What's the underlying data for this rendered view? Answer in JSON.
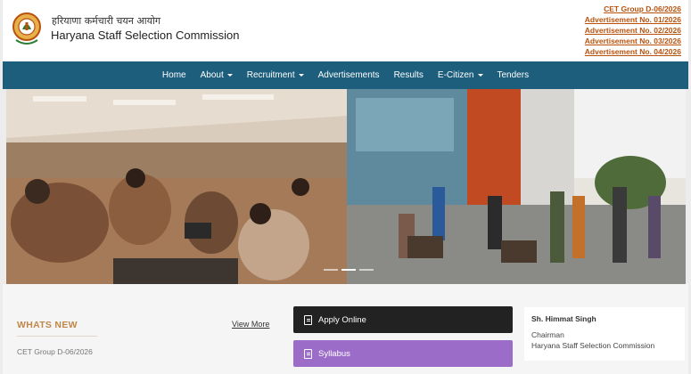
{
  "header": {
    "hindi_name": "हरियाणा कर्मचारी चयन आयोग",
    "org_name": "Haryana Staff Selection Commission",
    "links": [
      "CET Group D-06/2026",
      "Advertisement No. 01/2026",
      "Advertisement No. 02/2026",
      "Advertisement No. 03/2026",
      "Advertisement No. 04/2026"
    ]
  },
  "nav": {
    "items": [
      {
        "label": "Home",
        "dropdown": false
      },
      {
        "label": "About",
        "dropdown": true
      },
      {
        "label": "Recruitment",
        "dropdown": true
      },
      {
        "label": "Advertisements",
        "dropdown": false
      },
      {
        "label": "Results",
        "dropdown": false
      },
      {
        "label": "E-Citizen",
        "dropdown": true
      },
      {
        "label": "Tenders",
        "dropdown": false
      }
    ]
  },
  "whats_new": {
    "title": "WHATS NEW",
    "view_more": "View More",
    "items": [
      "CET Group D-06/2026"
    ]
  },
  "actions": {
    "apply_online": "Apply Online",
    "syllabus": "Syllabus"
  },
  "chairman": {
    "name": "Sh. Himmat Singh",
    "role": "Chairman",
    "org": "Haryana Staff Selection Commission"
  },
  "colors": {
    "nav_bg": "#1d5e7c",
    "link_orange": "#b8520d",
    "accent_gold": "#c0874a",
    "apply_bg": "#222222",
    "syllabus_bg": "#9b6dc8"
  }
}
